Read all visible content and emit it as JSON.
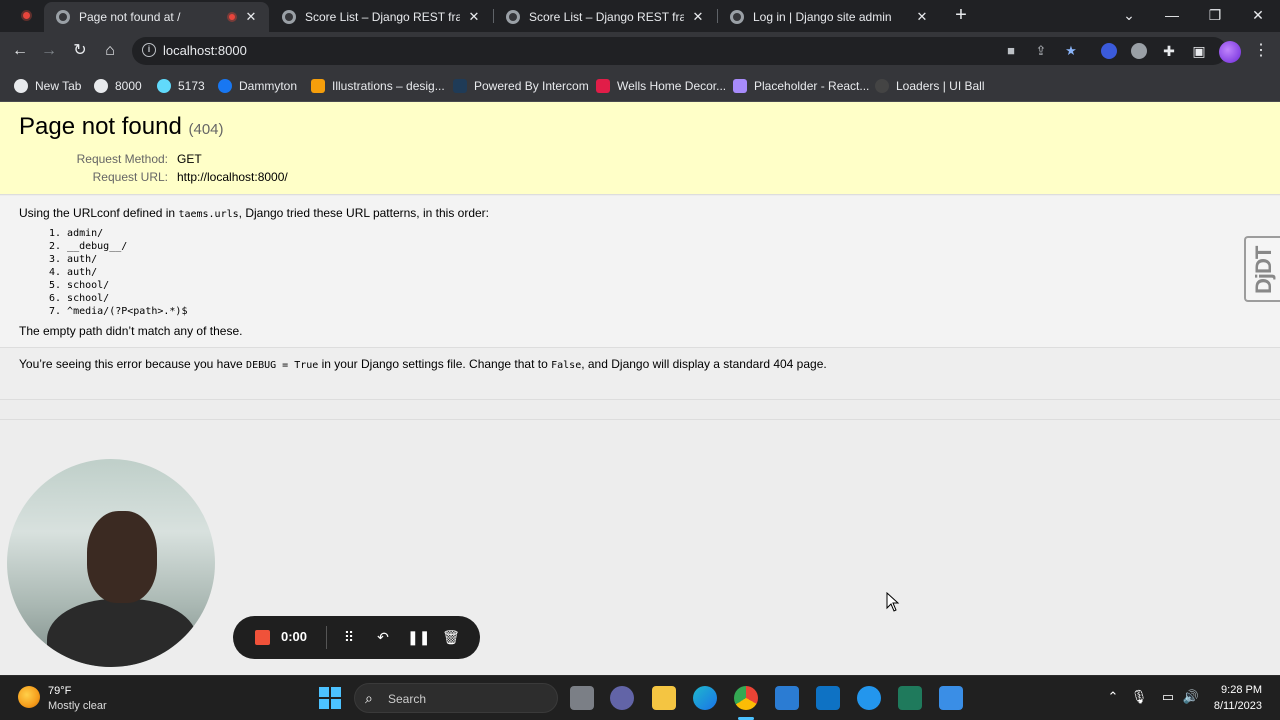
{
  "browser": {
    "tabs": [
      {
        "title": "Page not found at /",
        "active": true
      },
      {
        "title": "Score List – Django REST framew",
        "active": false
      },
      {
        "title": "Score List – Django REST framew",
        "active": false
      },
      {
        "title": "Log in | Django site admin",
        "active": false
      }
    ],
    "new_tab_glyph": "+",
    "url": "localhost:8000",
    "bookmarks": [
      {
        "label": "New Tab",
        "icon": "globe-icon",
        "color": "#e8eaed"
      },
      {
        "label": "8000",
        "icon": "globe-icon",
        "color": "#e8eaed"
      },
      {
        "label": "5173",
        "icon": "react-icon",
        "color": "#61dafb"
      },
      {
        "label": "Dammyton",
        "icon": "facebook-icon",
        "color": "#1877f2"
      },
      {
        "label": "Illustrations – desig...",
        "icon": "illustration-icon",
        "color": "#f59e0b"
      },
      {
        "label": "Powered By Intercom",
        "icon": "intercom-icon",
        "color": "#1f3b57"
      },
      {
        "label": "Wells Home Decor...",
        "icon": "wells-icon",
        "color": "#e11d48"
      },
      {
        "label": "Placeholder - React...",
        "icon": "placeholder-icon",
        "color": "#a78bfa"
      },
      {
        "label": "Loaders | UI Ball",
        "icon": "uiball-icon",
        "color": "#222222"
      }
    ]
  },
  "page": {
    "title": "Page not found",
    "status_code": "(404)",
    "request_method_label": "Request Method:",
    "request_method": "GET",
    "request_url_label": "Request URL:",
    "request_url": "http://localhost:8000/",
    "urlconf_prefix": "Using the URLconf defined in ",
    "urlconf_module": "taems.urls",
    "urlconf_suffix": ", Django tried these URL patterns, in this order:",
    "patterns": [
      "1.  admin/",
      "2.  __debug__/",
      "3.  auth/",
      "4.  auth/",
      "5.  school/",
      "6.  school/",
      "7.  ^media/(?P<path>.*)$"
    ],
    "no_match": "The empty path didn’t match any of these.",
    "explain_1": "You’re seeing this error because you have ",
    "explain_code1": "DEBUG = True",
    "explain_2": " in your Django settings file. Change that to ",
    "explain_code2": "False",
    "explain_3": ", and Django will display a standard 404 page.",
    "djdt_label": "DjDT"
  },
  "recorder": {
    "time": "0:00"
  },
  "taskbar": {
    "weather_temp": "79°F",
    "weather_condition": "Mostly clear",
    "search_label": "Search",
    "time": "9:28 PM",
    "date": "8/11/2023"
  }
}
